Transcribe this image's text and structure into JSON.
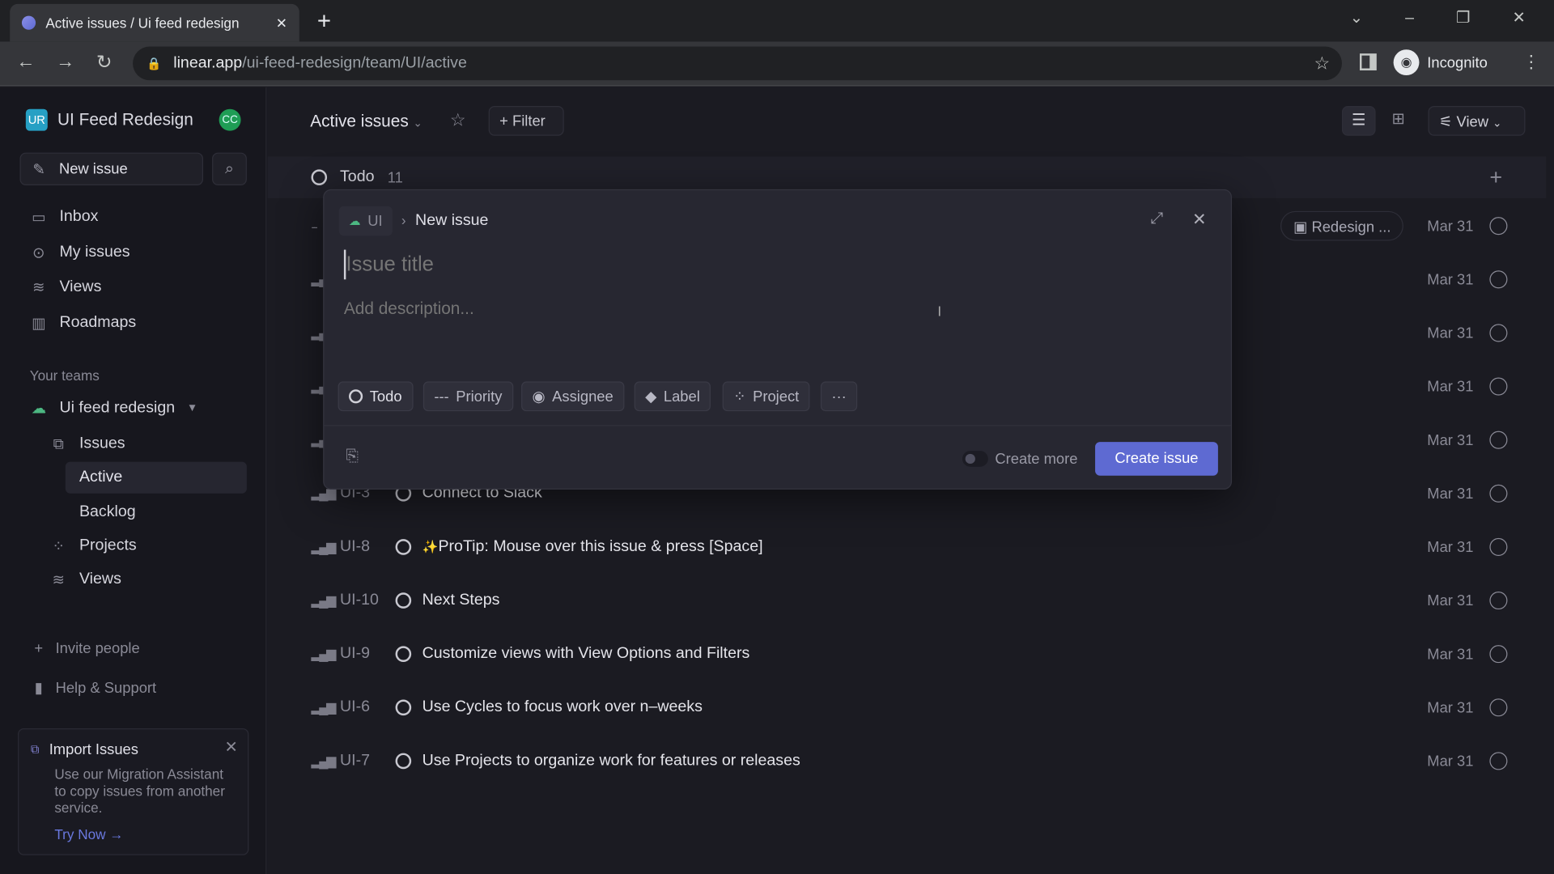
{
  "browser": {
    "tab_title": "Active issues / Ui feed redesign",
    "url_host": "linear.app",
    "url_path": "/ui-feed-redesign/team/UI/active",
    "profile": "Incognito"
  },
  "sidebar": {
    "workspace_initials": "UR",
    "workspace": "UI Feed Redesign",
    "user_initials": "CC",
    "new_issue": "New issue",
    "nav": [
      {
        "label": "Inbox",
        "icon": "inbox-icon"
      },
      {
        "label": "My issues",
        "icon": "target-icon"
      },
      {
        "label": "Views",
        "icon": "layers-icon"
      },
      {
        "label": "Roadmaps",
        "icon": "map-icon"
      }
    ],
    "teams_heading": "Your teams",
    "team": "Ui feed redesign",
    "team_items": {
      "issues": "Issues",
      "active": "Active",
      "backlog": "Backlog",
      "projects": "Projects",
      "views": "Views"
    },
    "invite": "Invite people",
    "help": "Help & Support",
    "import": {
      "title": "Import Issues",
      "body": "Use our Migration Assistant to copy issues from another service.",
      "link": "Try Now →"
    }
  },
  "header": {
    "view_title": "Active issues",
    "filter": "Filter",
    "view": "View"
  },
  "group": {
    "name": "Todo",
    "count": "11",
    "add": "+"
  },
  "issues": [
    {
      "id": "",
      "title": "",
      "date": "Mar 31",
      "project": "Redesign ...",
      "priority": "--"
    },
    {
      "id": "",
      "title": "",
      "date": "Mar 31"
    },
    {
      "id": "",
      "title": "",
      "date": "Mar 31"
    },
    {
      "id": "",
      "title": "",
      "date": "Mar 31"
    },
    {
      "id": "",
      "title": "",
      "date": "Mar 31"
    },
    {
      "id": "UI-3",
      "title": "Connect to Slack",
      "date": "Mar 31"
    },
    {
      "id": "UI-8",
      "title": "ProTip: Mouse over this issue & press [Space]",
      "date": "Mar 31",
      "sparkle": "✨"
    },
    {
      "id": "UI-10",
      "title": "Next Steps",
      "date": "Mar 31"
    },
    {
      "id": "UI-9",
      "title": "Customize views with View Options and Filters",
      "date": "Mar 31"
    },
    {
      "id": "UI-6",
      "title": "Use Cycles to focus work over n–weeks",
      "date": "Mar 31"
    },
    {
      "id": "UI-7",
      "title": "Use Projects to organize work for features or releases",
      "date": "Mar 31"
    }
  ],
  "modal": {
    "team": "UI",
    "breadcrumb": "New issue",
    "title_placeholder": "Issue title",
    "desc_placeholder": "Add description...",
    "chips": {
      "status": "Todo",
      "priority": "Priority",
      "assignee": "Assignee",
      "label": "Label",
      "project": "Project",
      "more": "···"
    },
    "create_more": "Create more",
    "create": "Create issue",
    "create_more_enabled": false
  },
  "colors": {
    "accent": "#5e6ad2",
    "team": "#4cb782",
    "workspace": "#26a0c4",
    "avatar": "#1f9d55"
  }
}
